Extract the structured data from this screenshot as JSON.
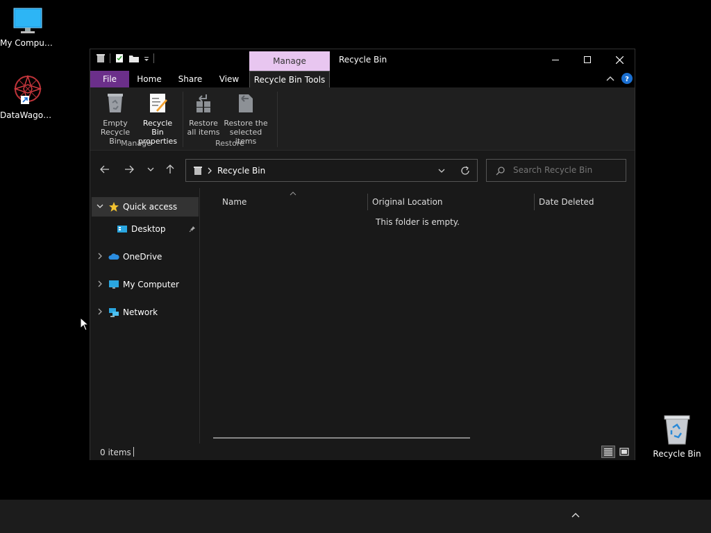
{
  "desktop": {
    "icons": [
      {
        "label": "My Computer",
        "icon": "monitor-icon"
      },
      {
        "label": "DataWagon...",
        "icon": "datawagon-shortcut-icon"
      },
      {
        "label": "Recycle Bin",
        "icon": "recycle-bin-icon"
      }
    ]
  },
  "window": {
    "title": "Recycle Bin",
    "contextual_tab": "Manage",
    "tabs": {
      "file": "File",
      "home": "Home",
      "share": "Share",
      "view": "View",
      "tools": "Recycle Bin Tools"
    },
    "ribbon": {
      "empty_line1": "Empty",
      "empty_line2": "Recycle Bin",
      "props_line1": "Recycle Bin",
      "props_line2": "properties",
      "restore_all_line1": "Restore",
      "restore_all_line2": "all items",
      "restore_sel_line1": "Restore the",
      "restore_sel_line2": "selected items",
      "group_manage": "Manage",
      "group_restore": "Restore"
    },
    "address": {
      "path": "Recycle Bin"
    },
    "search": {
      "placeholder": "Search Recycle Bin"
    },
    "nav_pane": {
      "quick_access": "Quick access",
      "desktop": "Desktop",
      "onedrive": "OneDrive",
      "my_computer": "My Computer",
      "network": "Network"
    },
    "columns": {
      "name": "Name",
      "original_location": "Original Location",
      "date_deleted": "Date Deleted"
    },
    "empty_message": "This folder is empty.",
    "status": {
      "item_count": "0 items"
    }
  },
  "colors": {
    "file_tab": "#6b2f8a",
    "manage_tab": "#e8c6f0",
    "window_bg": "#191919"
  }
}
